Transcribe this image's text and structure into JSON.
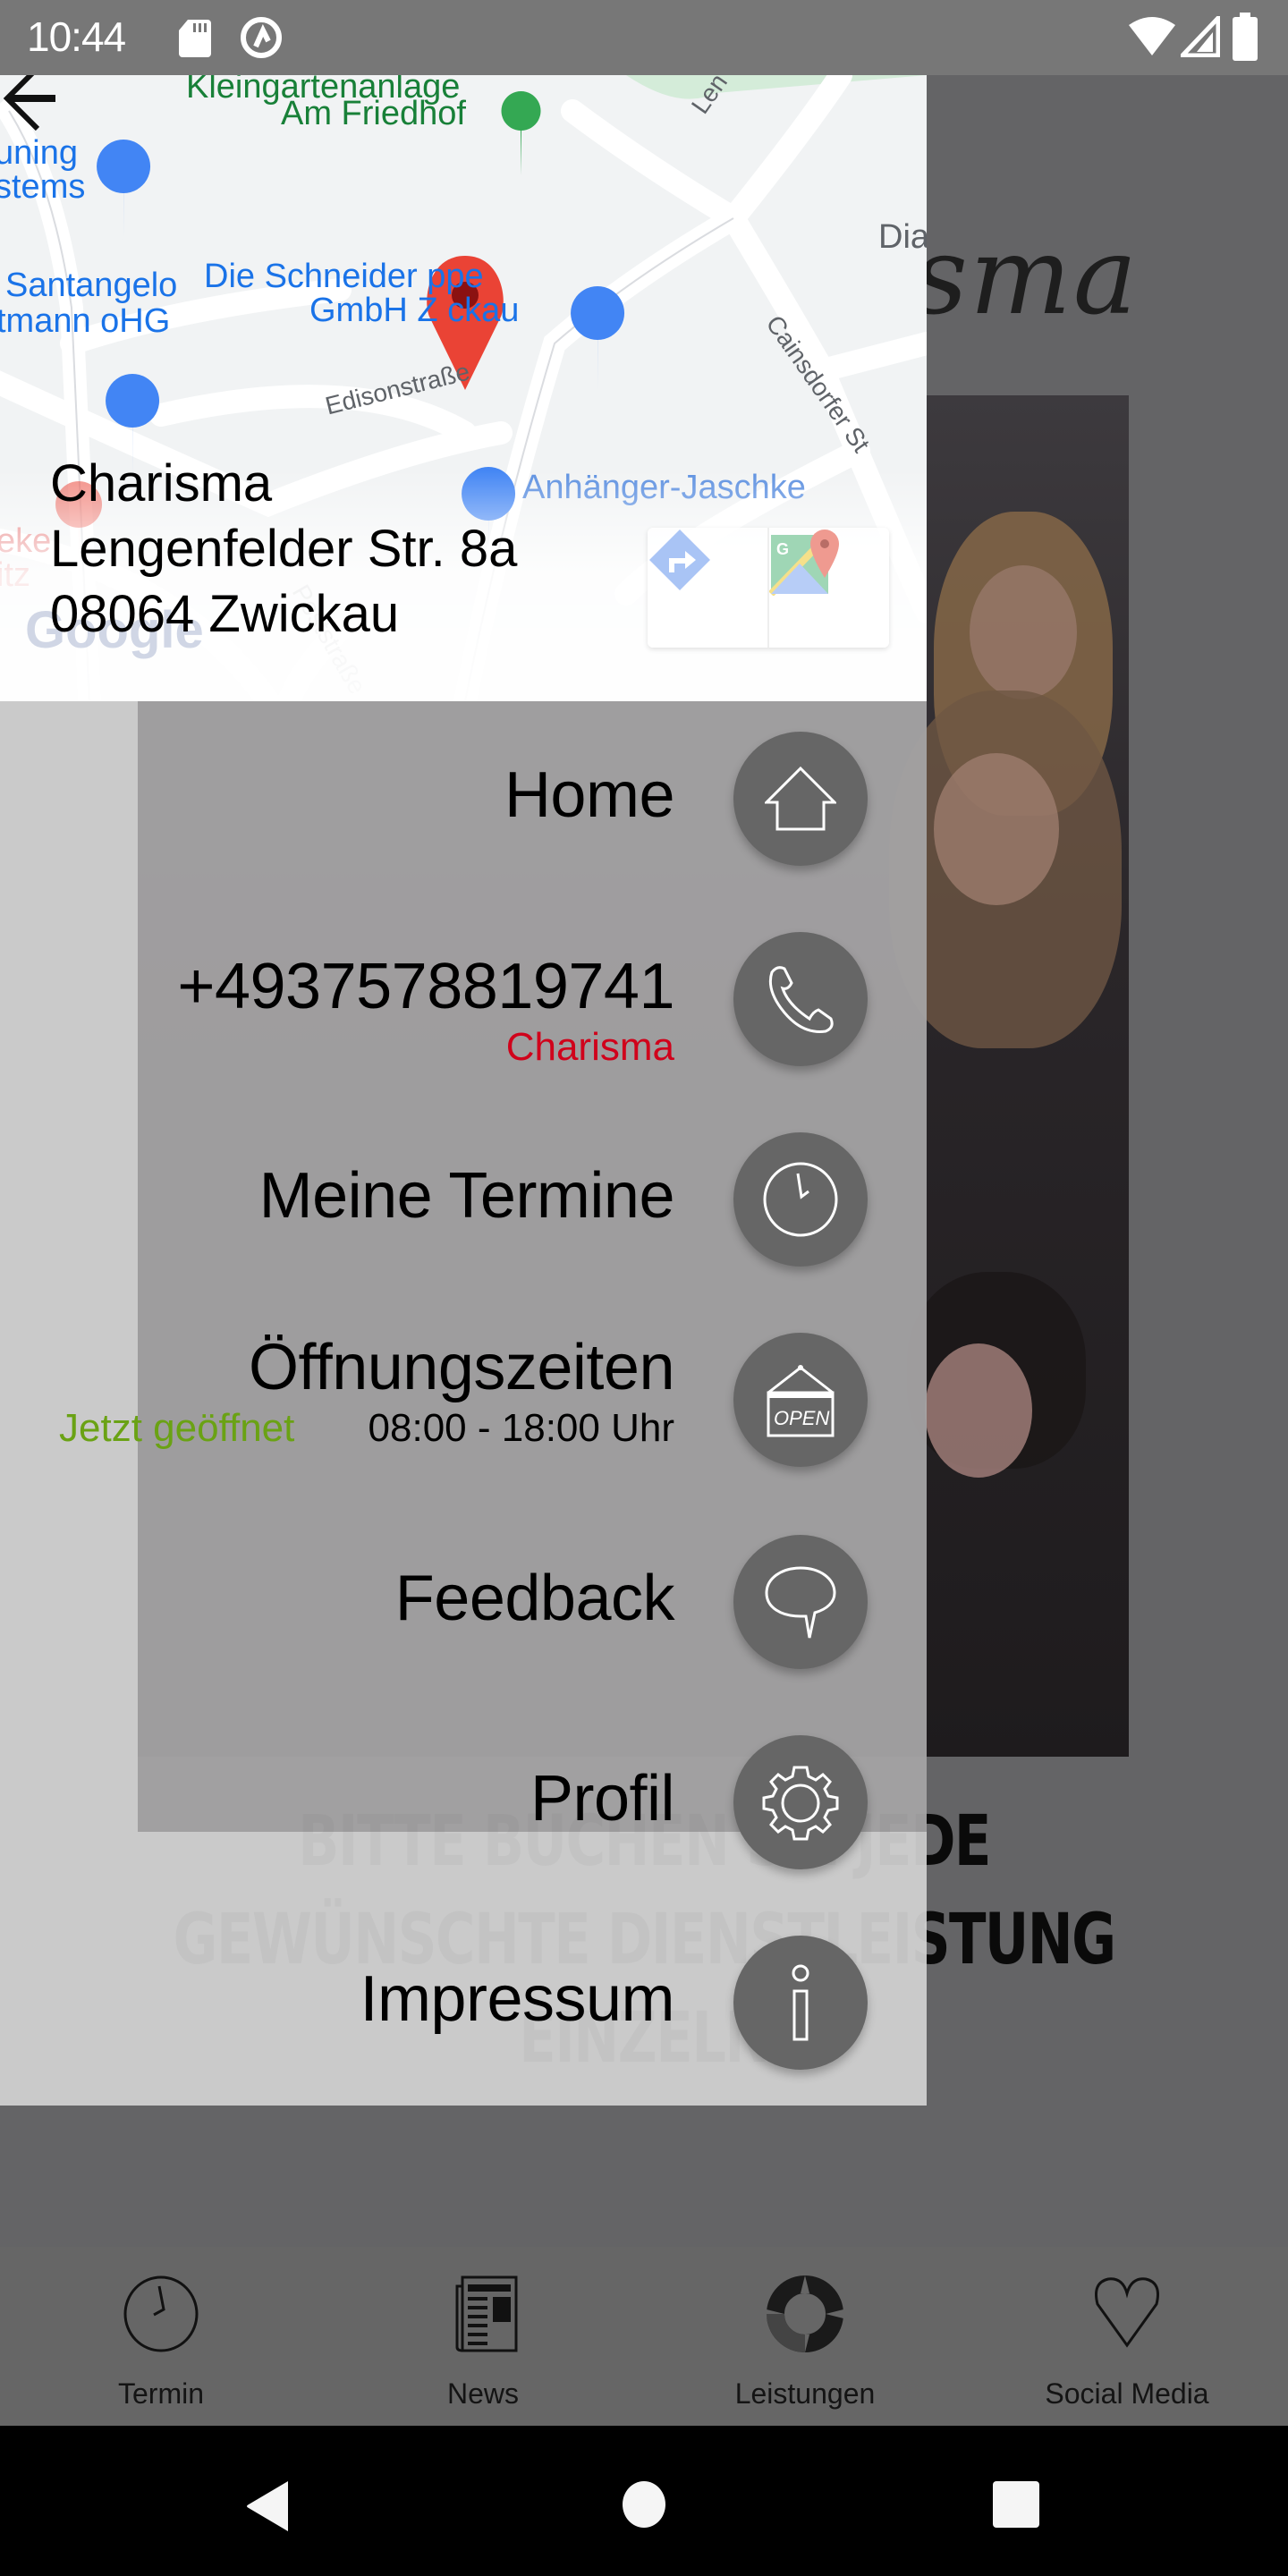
{
  "status_bar": {
    "time": "10:44",
    "left_icons": [
      "sd-card-icon",
      "at-sign-icon"
    ],
    "right_icons": [
      "wifi-icon",
      "cellular-signal-icon",
      "battery-icon"
    ]
  },
  "background_page": {
    "logo_text": "isma",
    "notice_lines": [
      "BITTE BUCHEN SIE JEDE",
      "GEWÜNSCHTE DIENSTLEISTUNG",
      "EINZELN"
    ]
  },
  "drawer": {
    "map": {
      "labels": {
        "park_line1": "Kleingartenanlage",
        "park_line2": "Am Friedhof",
        "poi_left_1": "uning",
        "poi_left_2": "stems",
        "santangelo_1": "Santangelo",
        "santangelo_2": "tmann oHG",
        "schneider_1": "Die Schneider    ppe",
        "schneider_2": "GmbH Z    ckau",
        "edison": "Edisonstraße",
        "anhaenger": "Anhänger-Jaschke",
        "dia": "Dia",
        "cainsdorfer": "Cainsdorfer St",
        "lengenfelder": "Len",
        "eke_1": "eke",
        "eke_2": "itz",
        "post": "Poststraße",
        "google": "Google"
      },
      "buttons": [
        {
          "name": "directions-button",
          "icon": "directions-icon"
        },
        {
          "name": "open-google-maps-button",
          "icon": "google-maps-icon"
        }
      ]
    },
    "address": {
      "name": "Charisma",
      "street": "Lengenfelder Str. 8a",
      "city": "08064 Zwickau"
    },
    "menu": [
      {
        "label": "Home",
        "icon": "home-icon"
      },
      {
        "label": "+4937578819741",
        "sublabel": "Charisma",
        "icon": "phone-icon"
      },
      {
        "label": "Meine Termine",
        "icon": "clock-icon"
      },
      {
        "label": "Öffnungszeiten",
        "status": "Jetzt geöffnet",
        "hours": "08:00 - 18:00 Uhr",
        "icon": "open-sign-icon"
      },
      {
        "label": "Feedback",
        "icon": "speech-bubble-icon"
      },
      {
        "label": "Profil",
        "icon": "gear-icon"
      },
      {
        "label": "Impressum",
        "icon": "info-icon"
      }
    ],
    "colors": {
      "phone_sublabel": "#d0021b",
      "open_status": "#6aa214",
      "fab": "#666666"
    }
  },
  "bottom_nav": [
    {
      "label": "Termin",
      "icon": "clock-icon"
    },
    {
      "label": "News",
      "icon": "newspaper-icon"
    },
    {
      "label": "Leistungen",
      "icon": "services-ring-icon"
    },
    {
      "label": "Social Media",
      "icon": "heart-icon"
    }
  ]
}
